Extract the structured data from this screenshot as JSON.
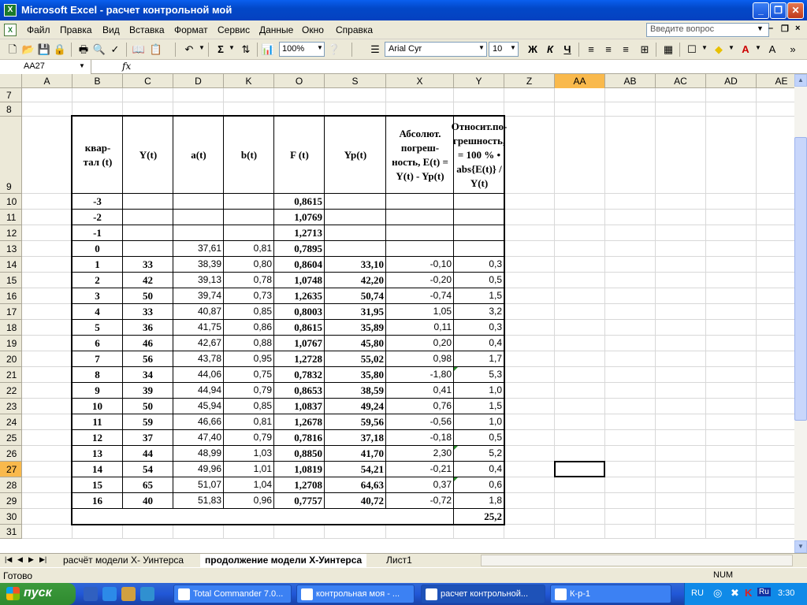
{
  "window": {
    "title": "Microsoft Excel - расчет контрольной мой",
    "min": "_",
    "restore": "❐",
    "close": "✕",
    "app_icon": "X"
  },
  "menu": {
    "items": [
      "Файл",
      "Правка",
      "Вид",
      "Вставка",
      "Формат",
      "Сервис",
      "Данные",
      "Окно",
      "Справка"
    ],
    "ask_placeholder": "Введите вопрос",
    "doc_min": "–",
    "doc_restore": "❐",
    "doc_close": "×"
  },
  "toolbar": {
    "zoom": "100%",
    "font": "Arial Cyr",
    "size": "10",
    "bold": "Ж",
    "italic": "К",
    "underline": "Ч",
    "sum": "Σ"
  },
  "formula": {
    "name_box": "AA27",
    "fx": "fx",
    "value": ""
  },
  "grid": {
    "col_labels": [
      "A",
      "B",
      "C",
      "D",
      "K",
      "O",
      "S",
      "X",
      "Y",
      "Z",
      "AA",
      "AB",
      "AC",
      "AD",
      "AE"
    ],
    "selected_col": "AA",
    "row_labels": [
      "7",
      "8",
      "9",
      "10",
      "11",
      "12",
      "13",
      "14",
      "15",
      "16",
      "17",
      "18",
      "19",
      "20",
      "21",
      "22",
      "23",
      "24",
      "25",
      "26",
      "27",
      "28",
      "29",
      "30",
      "31"
    ],
    "selected_row": "27",
    "selected_cell": "AA27"
  },
  "table": {
    "headers": [
      "квар-\nтал (t)",
      "Y(t)",
      "a(t)",
      "b(t)",
      "F (t)",
      "Yp(t)",
      "Абсолют. погреш-ность, E(t) = Y(t) - Yp(t)",
      "Относит.по-грешность, = 100 % • abs{E(t)} / Y(t)"
    ],
    "rows": [
      [
        "-3",
        "",
        "",
        "",
        "0,8615",
        "",
        "",
        ""
      ],
      [
        "-2",
        "",
        "",
        "",
        "1,0769",
        "",
        "",
        ""
      ],
      [
        "-1",
        "",
        "",
        "",
        "1,2713",
        "",
        "",
        ""
      ],
      [
        "0",
        "",
        "37,61",
        "0,81",
        "0,7895",
        "",
        "",
        ""
      ],
      [
        "1",
        "33",
        "38,39",
        "0,80",
        "0,8604",
        "33,10",
        "-0,10",
        "0,3"
      ],
      [
        "2",
        "42",
        "39,13",
        "0,78",
        "1,0748",
        "42,20",
        "-0,20",
        "0,5"
      ],
      [
        "3",
        "50",
        "39,74",
        "0,73",
        "1,2635",
        "50,74",
        "-0,74",
        "1,5"
      ],
      [
        "4",
        "33",
        "40,87",
        "0,85",
        "0,8003",
        "31,95",
        "1,05",
        "3,2"
      ],
      [
        "5",
        "36",
        "41,75",
        "0,86",
        "0,8615",
        "35,89",
        "0,11",
        "0,3"
      ],
      [
        "6",
        "46",
        "42,67",
        "0,88",
        "1,0767",
        "45,80",
        "0,20",
        "0,4"
      ],
      [
        "7",
        "56",
        "43,78",
        "0,95",
        "1,2728",
        "55,02",
        "0,98",
        "1,7"
      ],
      [
        "8",
        "34",
        "44,06",
        "0,75",
        "0,7832",
        "35,80",
        "-1,80",
        "5,3"
      ],
      [
        "9",
        "39",
        "44,94",
        "0,79",
        "0,8653",
        "38,59",
        "0,41",
        "1,0"
      ],
      [
        "10",
        "50",
        "45,94",
        "0,85",
        "1,0837",
        "49,24",
        "0,76",
        "1,5"
      ],
      [
        "11",
        "59",
        "46,66",
        "0,81",
        "1,2678",
        "59,56",
        "-0,56",
        "1,0"
      ],
      [
        "12",
        "37",
        "47,40",
        "0,79",
        "0,7816",
        "37,18",
        "-0,18",
        "0,5"
      ],
      [
        "13",
        "44",
        "48,99",
        "1,03",
        "0,8850",
        "41,70",
        "2,30",
        "5,2"
      ],
      [
        "14",
        "54",
        "49,96",
        "1,01",
        "1,0819",
        "54,21",
        "-0,21",
        "0,4"
      ],
      [
        "15",
        "65",
        "51,07",
        "1,04",
        "1,2708",
        "64,63",
        "0,37",
        "0,6"
      ],
      [
        "16",
        "40",
        "51,83",
        "0,96",
        "0,7757",
        "40,72",
        "-0,72",
        "1,8"
      ]
    ],
    "total": "25,2"
  },
  "sheets": {
    "tabs": [
      "расчёт модели X- Уинтерса",
      "продолжение модели X-Уинтерса",
      "Лист1"
    ],
    "active": 1
  },
  "status": {
    "text": "Готово",
    "num": "NUM"
  },
  "taskbar": {
    "start": "пуск",
    "tasks": [
      "Total Commander 7.0...",
      "контрольная моя - ...",
      "расчет контрольной...",
      "К-р-1"
    ],
    "active_task": 2,
    "lang": "RU",
    "clock": "3:30"
  }
}
